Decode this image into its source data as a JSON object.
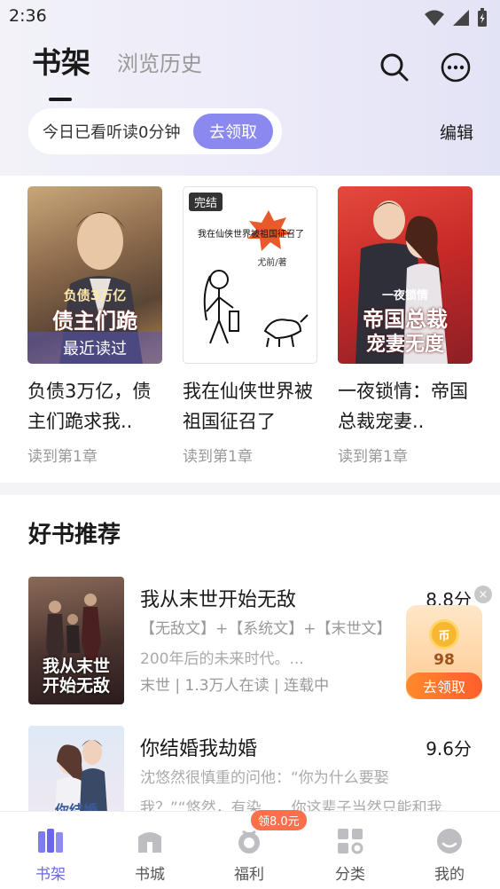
{
  "status_bar": {
    "time": "2:36"
  },
  "header": {
    "tab_shelf": "书架",
    "tab_history": "浏览历史",
    "search_icon": "search-icon",
    "more_icon": "more-icon"
  },
  "listen": {
    "text": "今日已看听读0分钟",
    "button": "去领取",
    "edit": "编辑"
  },
  "shelf": {
    "books": [
      {
        "title": "负债3万亿，债主们跪求我..",
        "progress": "读到第1章",
        "badge": "最近读过",
        "cover_text_1": "负债3万亿",
        "cover_text_2": "债主们跪"
      },
      {
        "title": "我在仙侠世界被祖国征召了",
        "progress": "读到第1章",
        "badge": "完结",
        "cover_line": "我在仙侠世界被祖国征召了",
        "cover_author": "尤前/著"
      },
      {
        "title": "一夜锁情：帝国总裁宠妻..",
        "progress": "读到第1章",
        "cover_text_1": "一夜锁情",
        "cover_text_2": "帝国总裁",
        "cover_text_3": "宠妻无度"
      }
    ]
  },
  "recommend": {
    "title": "好书推荐",
    "items": [
      {
        "name": "我从末世开始无敌",
        "score": "8.8分",
        "tags": "【无敌文】+【系统文】+【末世文】",
        "desc": "200年后的未来时代。...",
        "meta": "末世 | 1.3万人在读 | 连载中",
        "cover_text_1": "我从末世",
        "cover_text_2": "开始无敌"
      },
      {
        "name": "你结婚我劫婚",
        "score": "9.6分",
        "desc": "沈悠然很慎重的问他：“你为什么要娶",
        "desc2": "我？”“悠然，有染……你这辈子当然只能和我...",
        "cover_text_1": "你结婚"
      }
    ]
  },
  "reward_float": {
    "coin_symbol": "币",
    "value": "98",
    "button": "去领取",
    "close": "×"
  },
  "bottom_nav": {
    "items": [
      {
        "label": "书架",
        "icon": "bookshelf-icon",
        "active": true
      },
      {
        "label": "书城",
        "icon": "bookstore-icon"
      },
      {
        "label": "福利",
        "icon": "welfare-icon",
        "badge": "领8.0元"
      },
      {
        "label": "分类",
        "icon": "category-icon"
      },
      {
        "label": "我的",
        "icon": "profile-icon"
      }
    ]
  },
  "colors": {
    "accent": "#8b88f0",
    "nav_active": "#6b67e8",
    "badge_orange": "#ff6f4c"
  }
}
